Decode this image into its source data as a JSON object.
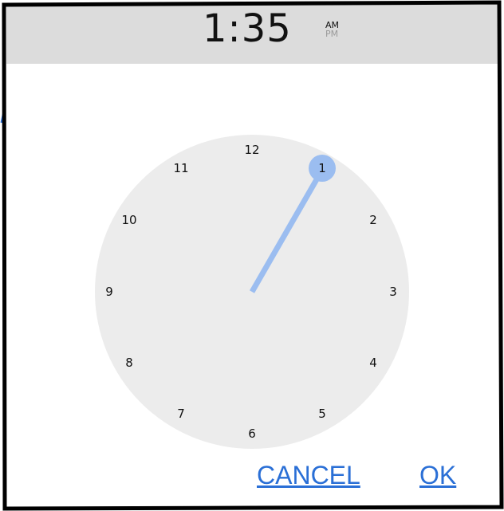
{
  "header": {
    "time": "1:35",
    "am_label": "AM",
    "pm_label": "PM",
    "selected_period": "AM"
  },
  "clock": {
    "numbers": [
      "12",
      "1",
      "2",
      "3",
      "4",
      "5",
      "6",
      "7",
      "8",
      "9",
      "10",
      "11"
    ],
    "selected_hour": "1",
    "hand_color": "#9bbdf0",
    "selector_color": "#9bbdf0",
    "face_color": "#ececec"
  },
  "actions": {
    "cancel_label": "CANCEL",
    "ok_label": "OK",
    "accent_color": "#2a6fd6"
  }
}
